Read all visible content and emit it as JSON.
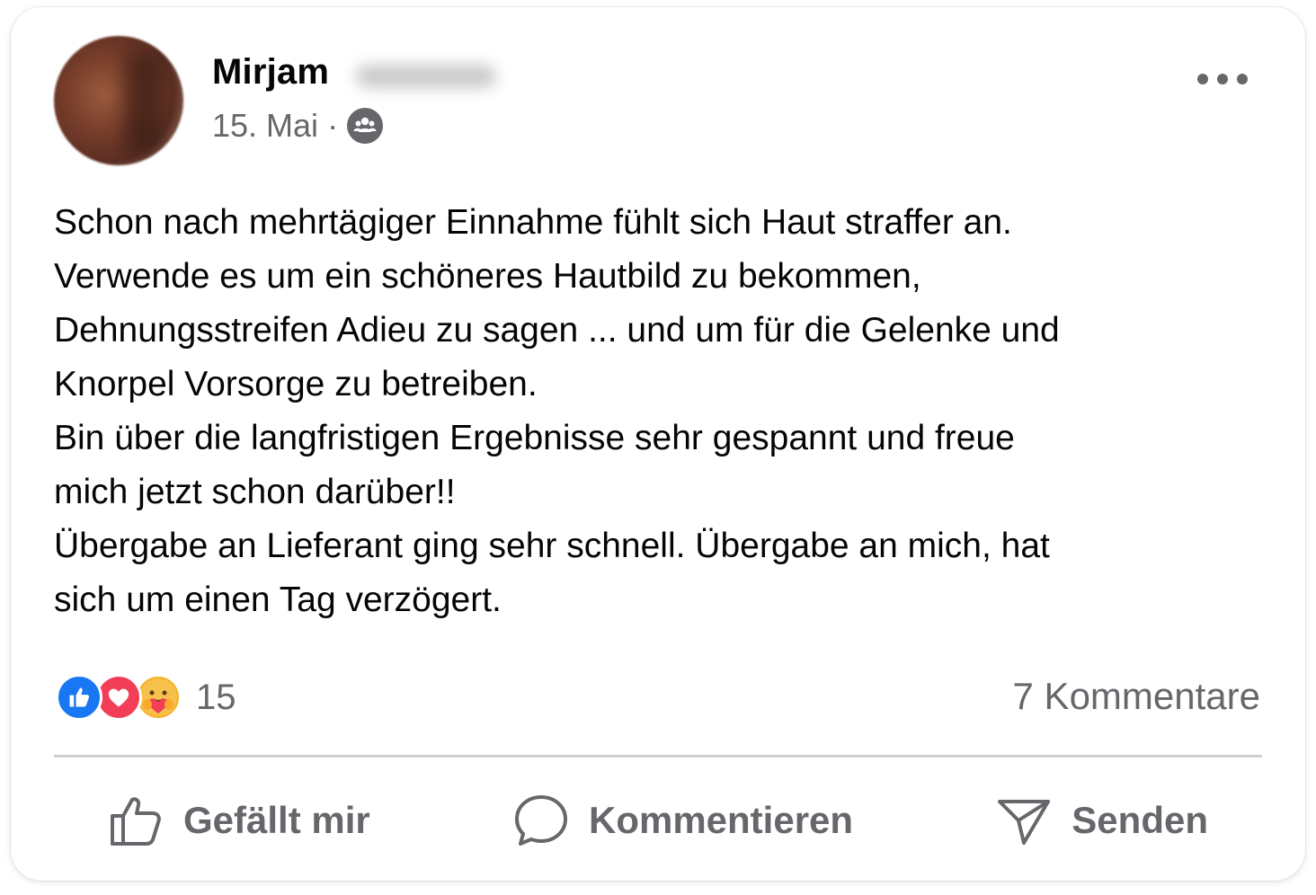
{
  "post": {
    "author": "Mirjam",
    "date": "15. Mai",
    "separator": "·",
    "audience_icon": "friends-icon",
    "text": "Schon nach mehrtägiger Einnahme fühlt sich Haut straffer an.\nVerwende es um ein schöneres Hautbild zu bekommen,\nDehnungsstreifen Adieu zu sagen ... und um für die Gelenke und\nKnorpel Vorsorge zu betreiben.\nBin über die langfristigen Ergebnisse sehr gespannt und freue\nmich jetzt schon darüber!!\nÜbergabe an Lieferant ging sehr schnell. Übergabe an mich, hat\nsich um einen Tag verzögert."
  },
  "reactions": {
    "icons": [
      "like-icon",
      "love-icon",
      "care-icon"
    ],
    "count": "15"
  },
  "comments": {
    "label": "7 Kommentare"
  },
  "actions": {
    "like_label": "Gefällt mir",
    "comment_label": "Kommentieren",
    "share_label": "Senden"
  },
  "colors": {
    "secondary_text": "#65676b",
    "like_blue": "#1877f2",
    "love_red": "#f33e58",
    "care_yellow": "#f7b125"
  }
}
